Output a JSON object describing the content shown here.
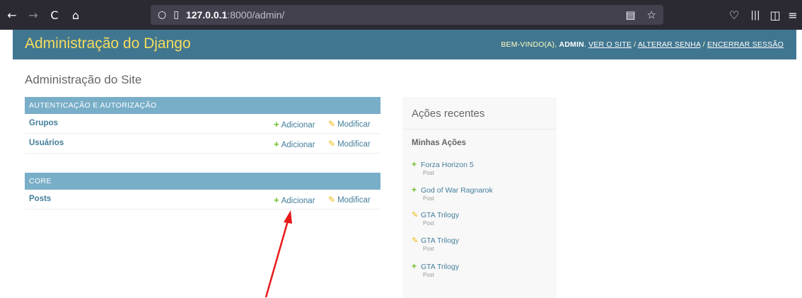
{
  "browser": {
    "back_glyph": "←",
    "forward_glyph": "→",
    "reload_glyph": "C",
    "home_glyph": "⌂",
    "shield_glyph": "○",
    "page_glyph": "▯",
    "url_host": "127.0.0.1",
    "url_rest": ":8000/admin/",
    "reader_glyph": "▤",
    "star_glyph": "☆",
    "pocket_glyph": "♡",
    "library_glyph": "|||",
    "sidebar_glyph": "◫",
    "menu_glyph": "≡"
  },
  "header": {
    "branding": "Administração do Django",
    "welcome": "BEM-VINDO(A), ",
    "username": "ADMIN",
    "view_site": "VER O SITE",
    "change_password": "ALTERAR SENHA",
    "logout": "ENCERRAR SESSÃO",
    "separator": " / "
  },
  "site_title": "Administração do Site",
  "modules": {
    "auth": {
      "caption": "AUTENTICAÇÃO E AUTORIZAÇÃO",
      "rows": [
        {
          "model": "Grupos",
          "add": "Adicionar",
          "change": "Modificar"
        },
        {
          "model": "Usuários",
          "add": "Adicionar",
          "change": "Modificar"
        }
      ]
    },
    "core": {
      "caption": "CORE",
      "rows": [
        {
          "model": "Posts",
          "add": "Adicionar",
          "change": "Modificar"
        }
      ]
    }
  },
  "icons": {
    "plus_glyph": "+",
    "pencil_glyph": "✎"
  },
  "recent": {
    "title": "Ações recentes",
    "subtitle": "Minhas Ações",
    "items": [
      {
        "action": "add",
        "title": "Forza Horizon 5",
        "type": "Post"
      },
      {
        "action": "add",
        "title": "God of War Ragnarok",
        "type": "Post"
      },
      {
        "action": "change",
        "title": "GTA Trilogy",
        "type": "Post"
      },
      {
        "action": "change",
        "title": "GTA Trilogy",
        "type": "Post"
      },
      {
        "action": "add",
        "title": "GTA Trilogy",
        "type": "Post"
      }
    ]
  },
  "colors": {
    "header_bg": "#417690",
    "branding": "#f5dd5d",
    "caption_bg": "#79aec8",
    "link": "#447e9b",
    "add_green": "#70bf2b",
    "change_yellow": "#efb80b",
    "annotation_arrow": "#e8191a"
  }
}
